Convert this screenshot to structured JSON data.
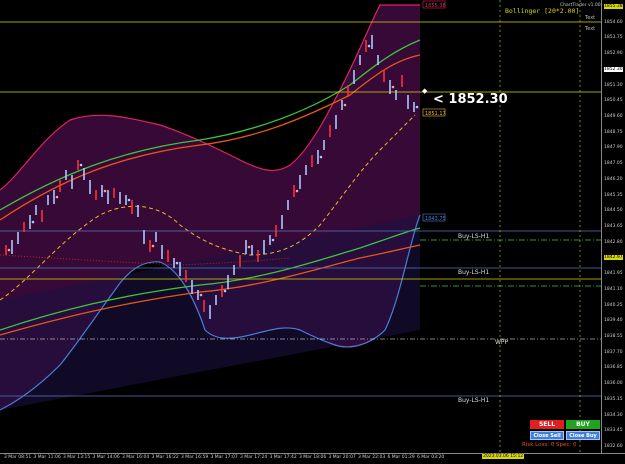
{
  "window": {
    "brand": "ChartTrader v1.00",
    "indicator_label": "Bollinger [20*2.00]",
    "overlay_label_1": "Text",
    "overlay_label_2": "Text"
  },
  "price_tag": {
    "label": "< 1852.30"
  },
  "levels": {
    "top_band": "1855.38",
    "mid_band_1": "1851.17",
    "lower_line": "1843.75",
    "buy_ls_1": "Buy-LS-H1",
    "buy_ls_2": "Buy-LS-H1",
    "buy_ls_3": "Buy-LS-H1",
    "wpp": "WPP",
    "right_tag_1": "1842.97"
  },
  "price_axis": {
    "ticks": [
      "1855.38",
      "1854.60",
      "1853.75",
      "1852.90",
      "1852.30",
      "1851.30",
      "1850.45",
      "1849.60",
      "1848.75",
      "1847.90",
      "1847.05",
      "1846.20",
      "1845.35",
      "1844.50",
      "1843.65",
      "1842.80",
      "1842.97",
      "1841.95",
      "1841.10",
      "1840.25",
      "1839.40",
      "1838.55",
      "1837.70",
      "1836.85",
      "1836.00",
      "1835.15",
      "1834.30",
      "1833.45",
      "1832.60"
    ]
  },
  "time_axis": {
    "ticks": [
      "3 Mar 08:51",
      "3 Mar 11:06",
      "3 Mar 13:15",
      "3 Mar 14:06",
      "3 Mar 16:04",
      "3 Mar 16:22",
      "3 Mar 16:59",
      "3 Mar 17:07",
      "3 Mar 17:24",
      "3 Mar 17:42",
      "3 Mar 18:06",
      "3 Mar 20:07",
      "3 Mar 22:03",
      "6 Mar 01:29",
      "6 Mar 03:20"
    ],
    "cursor_tag": "2023.03.06 15:12"
  },
  "trade_panel": {
    "sell_label": "SELL",
    "buy_label": "BUY",
    "close_sell_label": "Close Sell",
    "close_buy_label": "Close Buy",
    "info_text": "Risk Loss: 0 Spec: 0"
  },
  "colors": {
    "band_fill": "#3a0a3a",
    "band_line_upper": "#e0245e",
    "band_line_lower": "#4a7cd8",
    "ma_green": "#3ec43e",
    "ma_orange": "#e8551d",
    "mid_dashed": "#f0b42d",
    "sell": "#e02020",
    "buy": "#1fa41f",
    "close_blue": "#3f7fd6",
    "level_yellow": "#d8d800"
  }
}
